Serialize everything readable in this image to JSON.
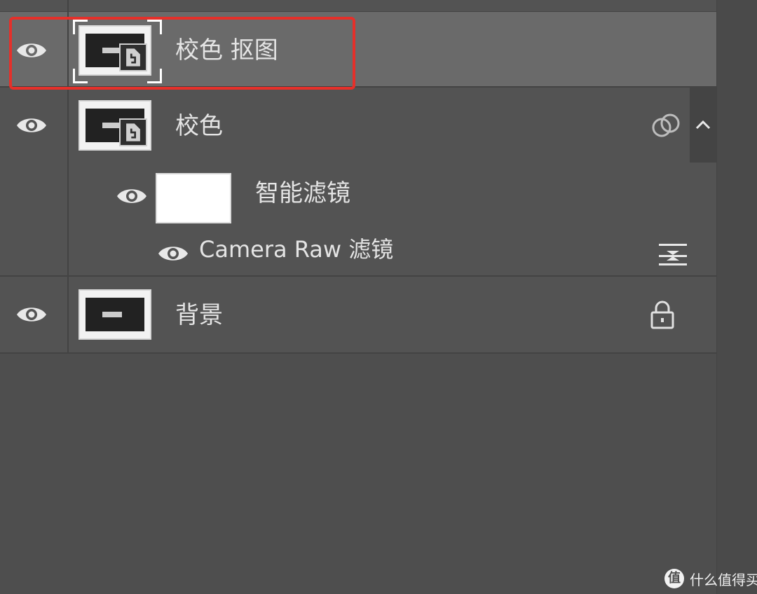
{
  "layers_panel": {
    "layers": [
      {
        "name": "校色 抠图",
        "visible": true,
        "selected": true,
        "icon": "eye-icon",
        "thumbnail": "smart-object-thumbnail"
      },
      {
        "name": "校色",
        "visible": true,
        "selected": false,
        "icon": "eye-icon",
        "thumbnail": "smart-object-thumbnail",
        "right_icon": "blend-circles-icon",
        "collapse_icon": "chevron-up-icon"
      },
      {
        "name": "背景",
        "visible": true,
        "selected": false,
        "icon": "eye-icon",
        "thumbnail": "image-thumbnail",
        "right_icon": "lock-icon"
      }
    ],
    "smart_filters": {
      "label": "智能滤镜",
      "visible": true,
      "mask": "white-mask-thumbnail",
      "filters": [
        {
          "name": "Camera Raw 滤镜",
          "visible": true,
          "options_icon": "filter-options-icon"
        }
      ]
    }
  },
  "annotation": {
    "color": "#e5302a",
    "target": "校色 抠图"
  },
  "watermark": {
    "logo_text": "值",
    "text": "什么值得买"
  },
  "colors": {
    "panel_bg": "#4e4e4e",
    "row_bg": "#535353",
    "selected_row_bg": "#6a6a6a",
    "text": "#e4e4e4"
  }
}
